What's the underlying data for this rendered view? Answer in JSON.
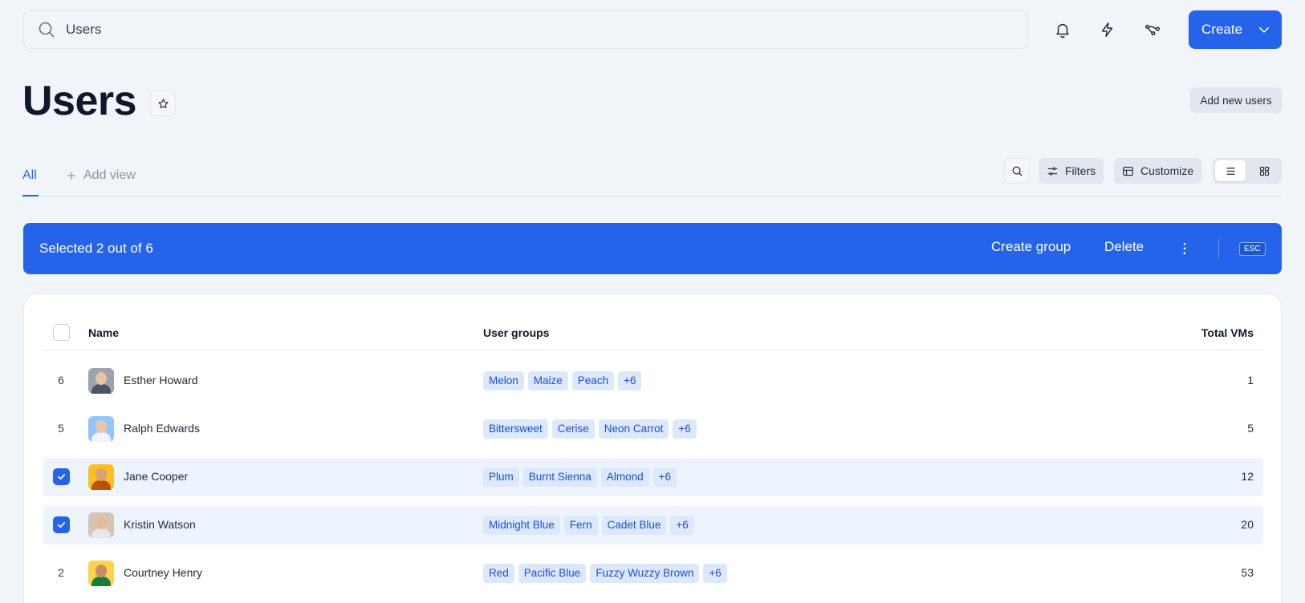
{
  "search": {
    "value": "Users"
  },
  "header": {
    "create_label": "Create"
  },
  "page": {
    "title": "Users",
    "add_users_label": "Add new users"
  },
  "tabs": {
    "all_label": "All",
    "add_view_label": "Add view"
  },
  "toolbar": {
    "filters_label": "Filters",
    "customize_label": "Customize"
  },
  "selection": {
    "text": "Selected 2 out of 6",
    "create_group_label": "Create group",
    "delete_label": "Delete",
    "esc_label": "ESC"
  },
  "table": {
    "columns": {
      "name": "Name",
      "groups": "User groups",
      "vms": "Total VMs"
    },
    "rows": [
      {
        "index": "6",
        "name": "Esther Howard",
        "groups": [
          "Melon",
          "Maize",
          "Peach",
          "+6"
        ],
        "vms": "1",
        "selected": false,
        "avatar_bg": "#9ca3af",
        "skin": "#e8c3a5",
        "shirt": "#4b5563"
      },
      {
        "index": "5",
        "name": "Ralph Edwards",
        "groups": [
          "Bittersweet",
          "Cerise",
          "Neon Carrot",
          "+6"
        ],
        "vms": "5",
        "selected": false,
        "avatar_bg": "#93c5fd",
        "skin": "#eac6a8",
        "shirt": "#f3f4f6"
      },
      {
        "index": "",
        "name": "Jane Cooper",
        "groups": [
          "Plum",
          "Burnt Sienna",
          "Almond",
          "+6"
        ],
        "vms": "12",
        "selected": true,
        "avatar_bg": "#fbbf24",
        "skin": "#d9a07a",
        "shirt": "#b45309"
      },
      {
        "index": "",
        "name": "Kristin Watson",
        "groups": [
          "Midnight Blue",
          "Fern",
          "Cadet Blue",
          "+6"
        ],
        "vms": "20",
        "selected": true,
        "avatar_bg": "#d6c4b4",
        "skin": "#e3bb9c",
        "shirt": "#e5e7eb"
      },
      {
        "index": "2",
        "name": "Courtney Henry",
        "groups": [
          "Red",
          "Pacific Blue",
          "Fuzzy Wuzzy Brown",
          "+6"
        ],
        "vms": "53",
        "selected": false,
        "avatar_bg": "#fcd34d",
        "skin": "#c98d66",
        "shirt": "#15803d"
      }
    ]
  },
  "icons": {
    "search": "search-icon",
    "bell": "bell-icon",
    "bolt": "bolt-icon",
    "workflow": "workflow-icon",
    "chevron": "chevron-down-icon",
    "star": "star-icon",
    "plus": "plus-icon",
    "filters": "sliders-icon",
    "customize": "table-icon",
    "list": "list-view-icon",
    "grid": "grid-view-icon",
    "more": "more-vertical-icon",
    "check": "check-icon"
  },
  "colors": {
    "accent": "#2563eb",
    "tag_bg": "#dde8fb",
    "tag_text": "#1d4ed8",
    "selected_row": "#eef4fe"
  }
}
